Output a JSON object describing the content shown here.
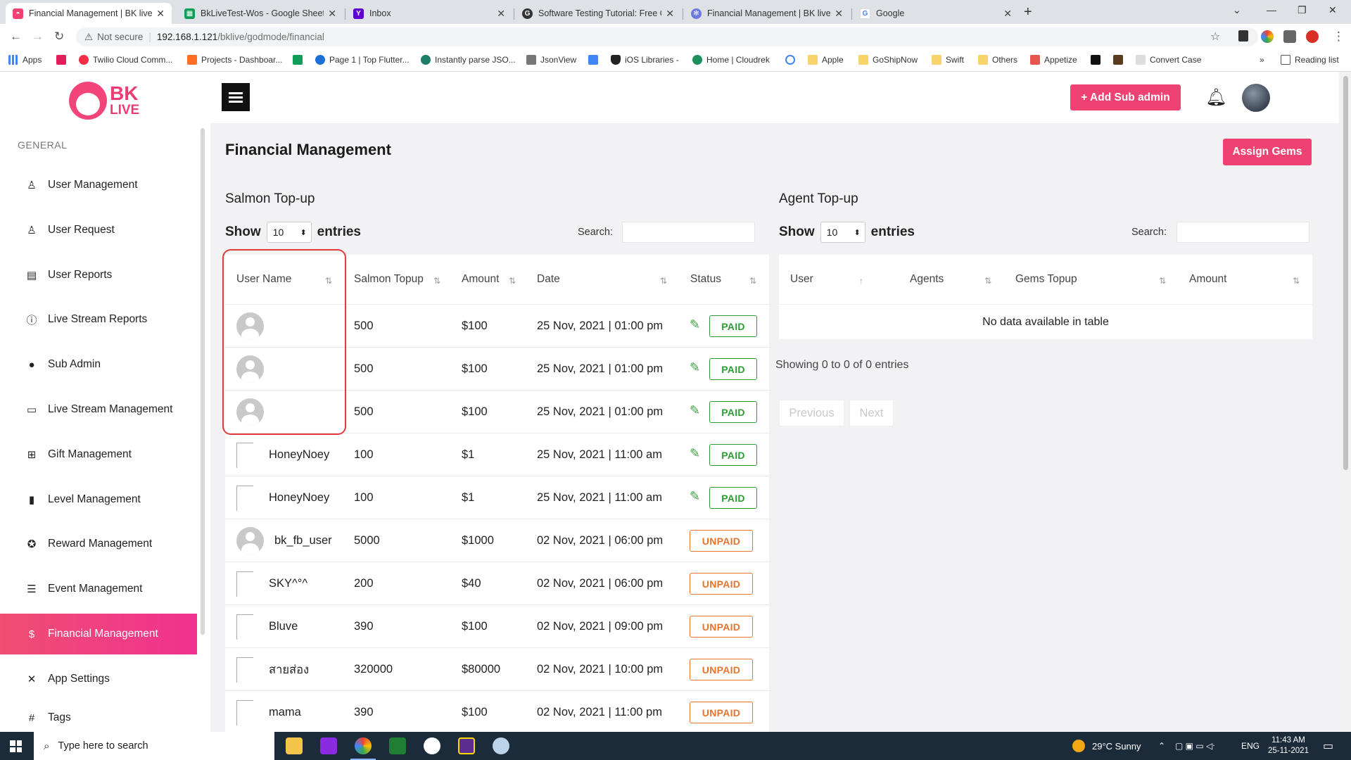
{
  "browser": {
    "tabs": [
      {
        "title": "Financial Management | BK live",
        "active": true
      },
      {
        "title": "BkLiveTest-Wos - Google Sheets"
      },
      {
        "title": "Inbox"
      },
      {
        "title": "Software Testing Tutorial: Free Q"
      },
      {
        "title": "Financial Management | BK live -"
      },
      {
        "title": "Google"
      }
    ],
    "not_secure": "Not secure",
    "url_host": "192.168.1.121",
    "url_path": "/bklive/godmode/financial",
    "bookmarks": [
      "Apps",
      "Twilio Cloud Comm...",
      "Projects - Dashboar...",
      "Page 1 | Top Flutter...",
      "Instantly parse JSO...",
      "JsonView",
      "iOS Libraries -",
      "Home | Cloudrek",
      "Apple",
      "GoShipNow",
      "Swift",
      "Others",
      "Appetize",
      "Convert Case"
    ],
    "reading_list": "Reading list"
  },
  "app": {
    "logo_bk": "BK",
    "logo_live": "LIVE",
    "section_label": "GENERAL",
    "nav": [
      {
        "label": "User Management",
        "icon": "user-icon"
      },
      {
        "label": "User Request",
        "icon": "user-add-icon"
      },
      {
        "label": "User Reports",
        "icon": "report-icon"
      },
      {
        "label": "Live Stream Reports",
        "icon": "alert-circle-icon"
      },
      {
        "label": "Sub Admin",
        "icon": "person-icon"
      },
      {
        "label": "Live Stream Management",
        "icon": "video-icon"
      },
      {
        "label": "Gift Management",
        "icon": "gift-icon"
      },
      {
        "label": "Level Management",
        "icon": "bar-chart-icon"
      },
      {
        "label": "Reward Management",
        "icon": "award-icon"
      },
      {
        "label": "Event Management",
        "icon": "clipboard-icon"
      },
      {
        "label": "Financial Management",
        "icon": "dollar-circle-icon",
        "active": true
      },
      {
        "label": "App Settings",
        "icon": "tools-icon"
      },
      {
        "label": "Tags",
        "icon": "hash-icon"
      }
    ],
    "add_sub_admin": "+ Add Sub admin"
  },
  "page": {
    "title": "Financial Management",
    "assign_gems": "Assign Gems"
  },
  "salmon": {
    "title": "Salmon Top-up",
    "show": "Show",
    "entries": "entries",
    "page_size": "10",
    "search_label": "Search:",
    "columns": [
      "User Name",
      "Salmon Topup",
      "Amount",
      "Date",
      "Status"
    ],
    "rows": [
      {
        "avatar": "default",
        "name": "",
        "topup": "500",
        "amount": "$100",
        "date": "25 Nov, 2021 | 01:00 pm",
        "status": "PAID"
      },
      {
        "avatar": "default",
        "name": "",
        "topup": "500",
        "amount": "$100",
        "date": "25 Nov, 2021 | 01:00 pm",
        "status": "PAID"
      },
      {
        "avatar": "default",
        "name": "",
        "topup": "500",
        "amount": "$100",
        "date": "25 Nov, 2021 | 01:00 pm",
        "status": "PAID"
      },
      {
        "avatar": "broken",
        "name": "HoneyNoey",
        "topup": "100",
        "amount": "$1",
        "date": "25 Nov, 2021 | 11:00 am",
        "status": "PAID"
      },
      {
        "avatar": "broken",
        "name": "HoneyNoey",
        "topup": "100",
        "amount": "$1",
        "date": "25 Nov, 2021 | 11:00 am",
        "status": "PAID"
      },
      {
        "avatar": "default",
        "name": "bk_fb_user",
        "topup": "5000",
        "amount": "$1000",
        "date": "02 Nov, 2021 | 06:00 pm",
        "status": "UNPAID"
      },
      {
        "avatar": "broken",
        "name": "SKY^°^",
        "topup": "200",
        "amount": "$40",
        "date": "02 Nov, 2021 | 06:00 pm",
        "status": "UNPAID"
      },
      {
        "avatar": "broken",
        "name": "Bluve",
        "topup": "390",
        "amount": "$100",
        "date": "02 Nov, 2021 | 09:00 pm",
        "status": "UNPAID"
      },
      {
        "avatar": "broken",
        "name": "สายส่อง",
        "topup": "320000",
        "amount": "$80000",
        "date": "02 Nov, 2021 | 10:00 pm",
        "status": "UNPAID"
      },
      {
        "avatar": "broken",
        "name": "mama",
        "topup": "390",
        "amount": "$100",
        "date": "02 Nov, 2021 | 11:00 pm",
        "status": "UNPAID"
      }
    ]
  },
  "agent": {
    "title": "Agent Top-up",
    "show": "Show",
    "entries": "entries",
    "page_size": "10",
    "search_label": "Search:",
    "columns": [
      "User",
      "Agents",
      "Gems Topup",
      "Amount"
    ],
    "empty": "No data available in table",
    "info": "Showing 0 to 0 of 0 entries",
    "previous": "Previous",
    "next": "Next"
  },
  "taskbar": {
    "search_placeholder": "Type here to search",
    "weather": "29°C  Sunny",
    "lang": "ENG",
    "time": "11:43 AM",
    "date": "25-11-2021"
  },
  "colors": {
    "accent": "#ee4272",
    "paid": "#2d9b36",
    "unpaid": "#e8742c"
  }
}
